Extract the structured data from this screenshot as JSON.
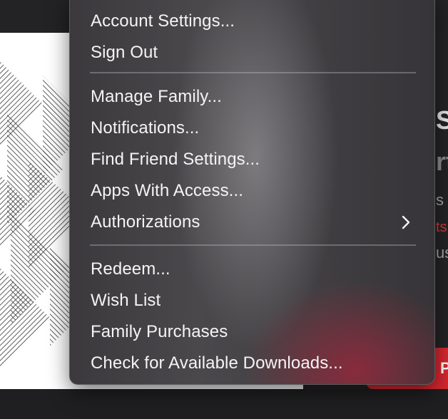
{
  "background": {
    "right_panel": {
      "title_1": "S",
      "title_2": "rt",
      "sub_1": "s",
      "sub_2": "ts",
      "sub_3": "us",
      "play_label": "Pla"
    }
  },
  "menu": {
    "group_1": [
      {
        "label": "Account Settings..."
      },
      {
        "label": "Sign Out"
      }
    ],
    "group_2": [
      {
        "label": "Manage Family..."
      },
      {
        "label": "Notifications..."
      },
      {
        "label": "Find Friend Settings..."
      },
      {
        "label": "Apps With Access..."
      },
      {
        "label": "Authorizations",
        "has_submenu": true,
        "icon": "chevron-right-icon"
      }
    ],
    "group_3": [
      {
        "label": "Redeem..."
      },
      {
        "label": "Wish List"
      },
      {
        "label": "Family Purchases"
      },
      {
        "label": "Check for Available Downloads..."
      }
    ]
  },
  "colors": {
    "accent_red": "#d9272f",
    "menu_text": "#f4f4f5"
  }
}
